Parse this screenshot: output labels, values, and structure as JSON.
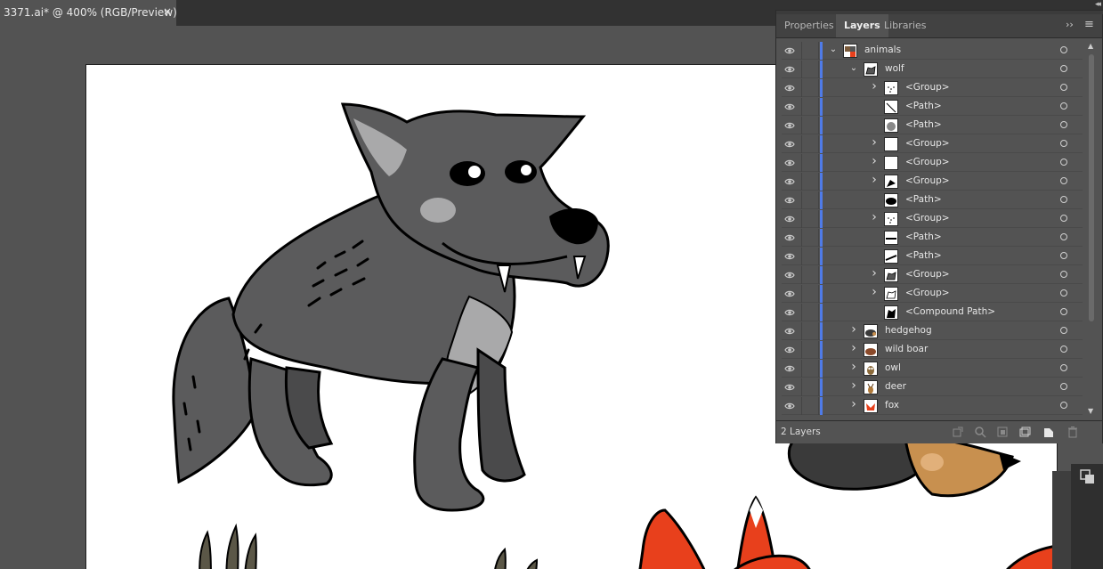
{
  "document": {
    "tab_title": "3371.ai* @ 400% (RGB/Preview)",
    "close_glyph": "×"
  },
  "panel": {
    "tabs": [
      {
        "label": "Properties",
        "active": false
      },
      {
        "label": "Layers",
        "active": true
      },
      {
        "label": "Libraries",
        "active": false
      }
    ],
    "expand_glyph": "››",
    "menu_glyph": "≡",
    "footer_count": "2 Layers",
    "accent_color": "#4f7be8",
    "layers": [
      {
        "name": "animals",
        "indent": 0,
        "expanded": true,
        "thumb": "animals-thumb"
      },
      {
        "name": "wolf",
        "indent": 1,
        "expanded": true,
        "thumb": "wolf-thumb"
      },
      {
        "name": "<Group>",
        "indent": 2,
        "expanded": false,
        "thumb": "dots-thumb"
      },
      {
        "name": "<Path>",
        "indent": 2,
        "expanded": null,
        "thumb": "line-thumb"
      },
      {
        "name": "<Path>",
        "indent": 2,
        "expanded": null,
        "thumb": "gray-blob-thumb"
      },
      {
        "name": "<Group>",
        "indent": 2,
        "expanded": false,
        "thumb": "blank-thumb"
      },
      {
        "name": "<Group>",
        "indent": 2,
        "expanded": false,
        "thumb": "blank-thumb"
      },
      {
        "name": "<Group>",
        "indent": 2,
        "expanded": false,
        "thumb": "shape-thumb"
      },
      {
        "name": "<Path>",
        "indent": 2,
        "expanded": null,
        "thumb": "black-blob-thumb"
      },
      {
        "name": "<Group>",
        "indent": 2,
        "expanded": false,
        "thumb": "dots-thumb"
      },
      {
        "name": "<Path>",
        "indent": 2,
        "expanded": null,
        "thumb": "stroke-thumb"
      },
      {
        "name": "<Path>",
        "indent": 2,
        "expanded": null,
        "thumb": "stroke2-thumb"
      },
      {
        "name": "<Group>",
        "indent": 2,
        "expanded": false,
        "thumb": "wolf-small-thumb"
      },
      {
        "name": "<Group>",
        "indent": 2,
        "expanded": false,
        "thumb": "outline-thumb"
      },
      {
        "name": "<Compound Path>",
        "indent": 2,
        "expanded": null,
        "thumb": "wolf-black-thumb"
      },
      {
        "name": "hedgehog",
        "indent": 1,
        "expanded": false,
        "thumb": "hedgehog-thumb"
      },
      {
        "name": "wild boar",
        "indent": 1,
        "expanded": false,
        "thumb": "boar-thumb"
      },
      {
        "name": "owl",
        "indent": 1,
        "expanded": false,
        "thumb": "owl-thumb"
      },
      {
        "name": "deer",
        "indent": 1,
        "expanded": false,
        "thumb": "deer-thumb"
      },
      {
        "name": "fox",
        "indent": 1,
        "expanded": false,
        "thumb": "fox-thumb"
      }
    ]
  }
}
